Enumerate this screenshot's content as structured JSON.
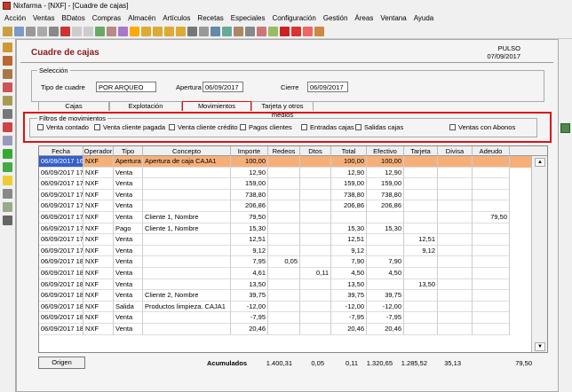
{
  "window": {
    "title": "Nixfarma - [NXF] - [Cuadre de cajas]"
  },
  "menu": [
    "Acción",
    "Ventas",
    "BDatos",
    "Compras",
    "Almacén",
    "Artículos",
    "Recetas",
    "Especiales",
    "Configuración",
    "Gestión",
    "Áreas",
    "Ventana",
    "Ayuda"
  ],
  "form": {
    "title": "Cuadre de cajas",
    "status_line1": "PULSO",
    "status_line2": "07/09/2017"
  },
  "seleccion": {
    "legend": "Selección",
    "tipo_label": "Tipo de cuadre",
    "tipo_value": "POR ARQUEO",
    "apertura_label": "Apertura",
    "apertura_value": "06/09/2017",
    "cierre_label": "Cierre",
    "cierre_value": "06/09/2017"
  },
  "tabs": [
    "Cajas",
    "Explotación",
    "Movimientos",
    "Tarjeta y otros medios"
  ],
  "filtros": {
    "legend": "Filtros de movimientos",
    "options": [
      "Venta contado",
      "Venta cliente pagada",
      "Venta cliente crédito",
      "Pagos clientes",
      "Entradas cajas",
      "Salidas cajas",
      "Ventas con Abonos"
    ]
  },
  "grid": {
    "columns": [
      "Fecha",
      "Operador",
      "Tipo",
      "Concepto",
      "Importe",
      "Redeos",
      "Dtos",
      "Total",
      "Efectivo",
      "Tarjeta",
      "Divisa",
      "Adeudo"
    ],
    "rows": [
      [
        "06/09/2017 16:28",
        "NXF",
        "Apertura",
        "Apertura de caja CAJA1",
        "100,00",
        "",
        "",
        "100,00",
        "100,00",
        "",
        "",
        ""
      ],
      [
        "06/09/2017 17:44",
        "NXF",
        "Venta",
        "",
        "12,90",
        "",
        "",
        "12,90",
        "12,90",
        "",
        "",
        ""
      ],
      [
        "06/09/2017 17:44",
        "NXF",
        "Venta",
        "",
        "159,00",
        "",
        "",
        "159,00",
        "159,00",
        "",
        "",
        ""
      ],
      [
        "06/09/2017 17:47",
        "NXF",
        "Venta",
        "",
        "738,80",
        "",
        "",
        "738,80",
        "738,80",
        "",
        "",
        ""
      ],
      [
        "06/09/2017 17:49",
        "NXF",
        "Venta",
        "",
        "206,86",
        "",
        "",
        "206,86",
        "206,86",
        "",
        "",
        ""
      ],
      [
        "06/09/2017 17:50",
        "NXF",
        "Venta",
        "Cliente 1, Nombre",
        "79,50",
        "",
        "",
        "",
        "",
        "",
        "",
        "79,50"
      ],
      [
        "06/09/2017 17:59",
        "NXF",
        "Pago",
        "Cliente 1, Nombre",
        "15,30",
        "",
        "",
        "15,30",
        "15,30",
        "",
        "",
        ""
      ],
      [
        "06/09/2017 17:59",
        "NXF",
        "Venta",
        "",
        "12,51",
        "",
        "",
        "12,51",
        "",
        "12,51",
        "",
        ""
      ],
      [
        "06/09/2017 17:59",
        "NXF",
        "Venta",
        "",
        "9,12",
        "",
        "",
        "9,12",
        "",
        "9,12",
        "",
        ""
      ],
      [
        "06/09/2017 18:05",
        "NXF",
        "Venta",
        "",
        "7,95",
        "0,05",
        "",
        "7,90",
        "7,90",
        "",
        "",
        ""
      ],
      [
        "06/09/2017 18:06",
        "NXF",
        "Venta",
        "",
        "4,61",
        "",
        "0,11",
        "4,50",
        "4,50",
        "",
        "",
        ""
      ],
      [
        "06/09/2017 18:06",
        "NXF",
        "Venta",
        "",
        "13,50",
        "",
        "",
        "13,50",
        "",
        "13,50",
        "",
        ""
      ],
      [
        "06/09/2017 18:10",
        "NXF",
        "Venta",
        "Cliente 2, Nombre",
        "39,75",
        "",
        "",
        "39,75",
        "39,75",
        "",
        "",
        ""
      ],
      [
        "06/09/2017 18:11",
        "NXF",
        "Salida",
        "Productos limpieza. CAJA1",
        "-12,00",
        "",
        "",
        "-12,00",
        "-12,00",
        "",
        "",
        ""
      ],
      [
        "06/09/2017 18:12",
        "NXF",
        "Venta",
        "",
        "-7,95",
        "",
        "",
        "-7,95",
        "-7,95",
        "",
        "",
        ""
      ],
      [
        "06/09/2017 18:12",
        "NXF",
        "Venta",
        "",
        "20,46",
        "",
        "",
        "20,46",
        "20,46",
        "",
        "",
        ""
      ]
    ]
  },
  "footer": {
    "origen_label": "Origen",
    "acumulados_label": "Acumulados",
    "totals": {
      "importe": "1.400,31",
      "redeos": "0,05",
      "dtos": "0,11",
      "total": "1.320,65",
      "efectivo": "1.285,52",
      "tarjeta": "35,13",
      "adeudo": "79,50"
    }
  }
}
